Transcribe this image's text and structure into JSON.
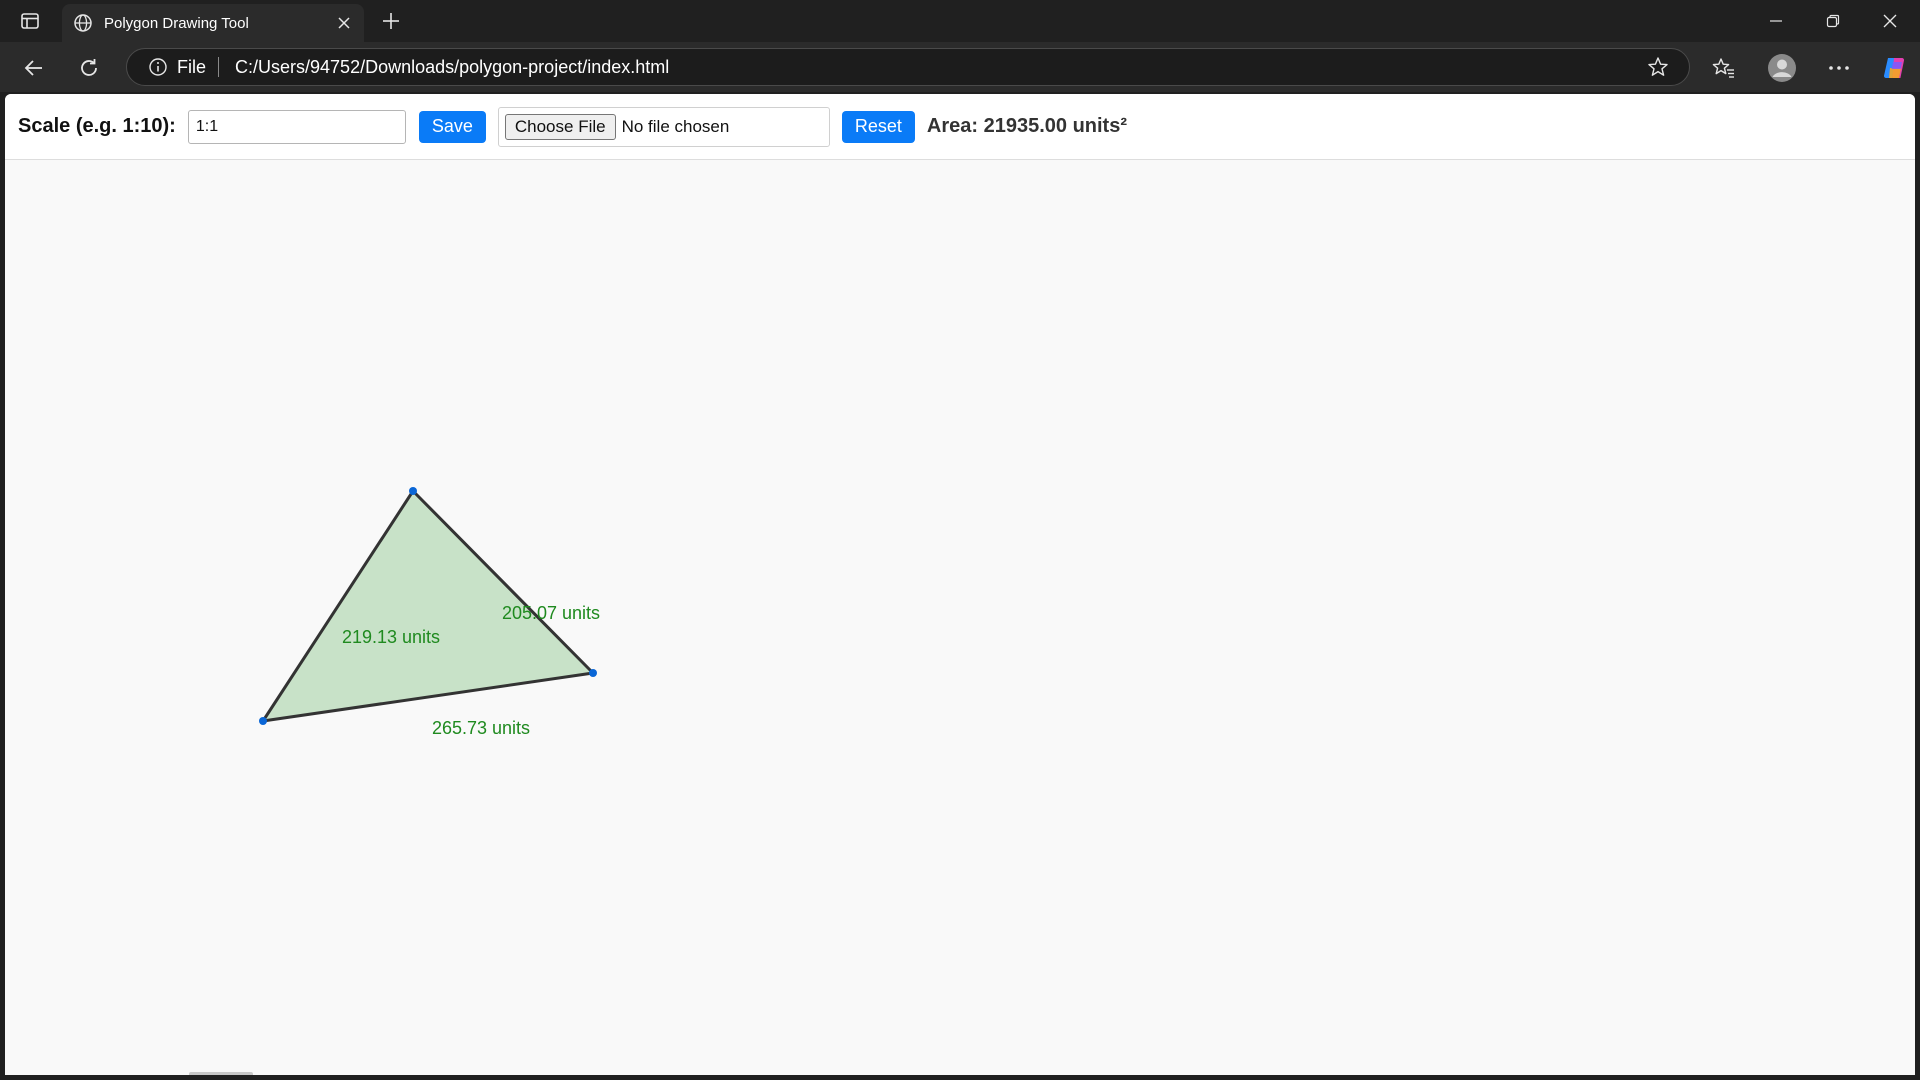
{
  "browser": {
    "tab_title": "Polygon Drawing Tool",
    "address_scheme": "File",
    "url": "C:/Users/94752/Downloads/polygon-project/index.html"
  },
  "controls": {
    "scale_label": "Scale (e.g. 1:10):",
    "scale_value": "1:1",
    "save_label": "Save",
    "choose_file_label": "Choose File",
    "no_file_text": "No file chosen",
    "reset_label": "Reset",
    "area_text": "Area: 21935.00 units²"
  },
  "polygon": {
    "fill_color": "#c8e2c8",
    "stroke_color": "#333333",
    "vertex_color": "#0a66d6",
    "label_color": "#1f8a1f",
    "edge_labels": [
      "219.13 units",
      "205.07 units",
      "265.73 units"
    ]
  },
  "colors": {
    "accent": "#0a7bf7",
    "chrome_dark": "#202020",
    "chrome_toolbar": "#2b2b2b"
  }
}
